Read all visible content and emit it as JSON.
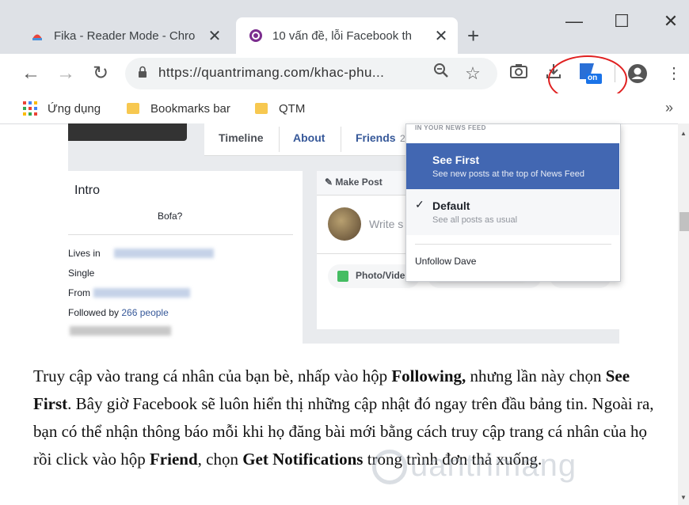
{
  "tabs": [
    {
      "title": "Fika - Reader Mode - Chro",
      "active": false
    },
    {
      "title": "10 vấn đề, lỗi Facebook th",
      "active": true
    }
  ],
  "url": "https://quantrimang.com/khac-phu...",
  "bookmarks": [
    "Ứng dụng",
    "Bookmarks bar",
    "QTM"
  ],
  "extension_badge": "on",
  "fb": {
    "tabs": [
      "Timeline",
      "About",
      "Friends"
    ],
    "friends_count": "2",
    "intro_title": "Intro",
    "bio": "Bofa?",
    "details": [
      "Lives in",
      "Single",
      "From",
      "Followed by"
    ],
    "followers_link": "266 people",
    "make_post": "Make Post",
    "write_placeholder": "Write s",
    "photo_video": "Photo/Vide",
    "menu": {
      "header": "IN YOUR NEWS FEED",
      "see_first": "See First",
      "see_first_desc": "See new posts at the top of News Feed",
      "default": "Default",
      "default_desc": "See all posts as usual",
      "unfollow": "Unfollow Dave"
    }
  },
  "article": {
    "p1": "Truy cập vào trang cá nhân của bạn bè, nhấp vào hộp ",
    "b1": "Following,",
    "p2": " nhưng lần này chọn ",
    "b2": "See First",
    "p3": ". Bây giờ Facebook sẽ luôn hiển thị những cập nhật đó ngay trên đầu bảng tin. Ngoài ra, bạn có thể nhận thông báo mỗi khi họ đăng bài mới bằng cách truy cập trang cá nhân của họ rồi click vào hộp ",
    "b3": "Friend",
    "p4": ", chọn ",
    "b4": "Get Notifications",
    "p5": " trong trình đơn thả xuống."
  },
  "watermark": "uantrimang"
}
